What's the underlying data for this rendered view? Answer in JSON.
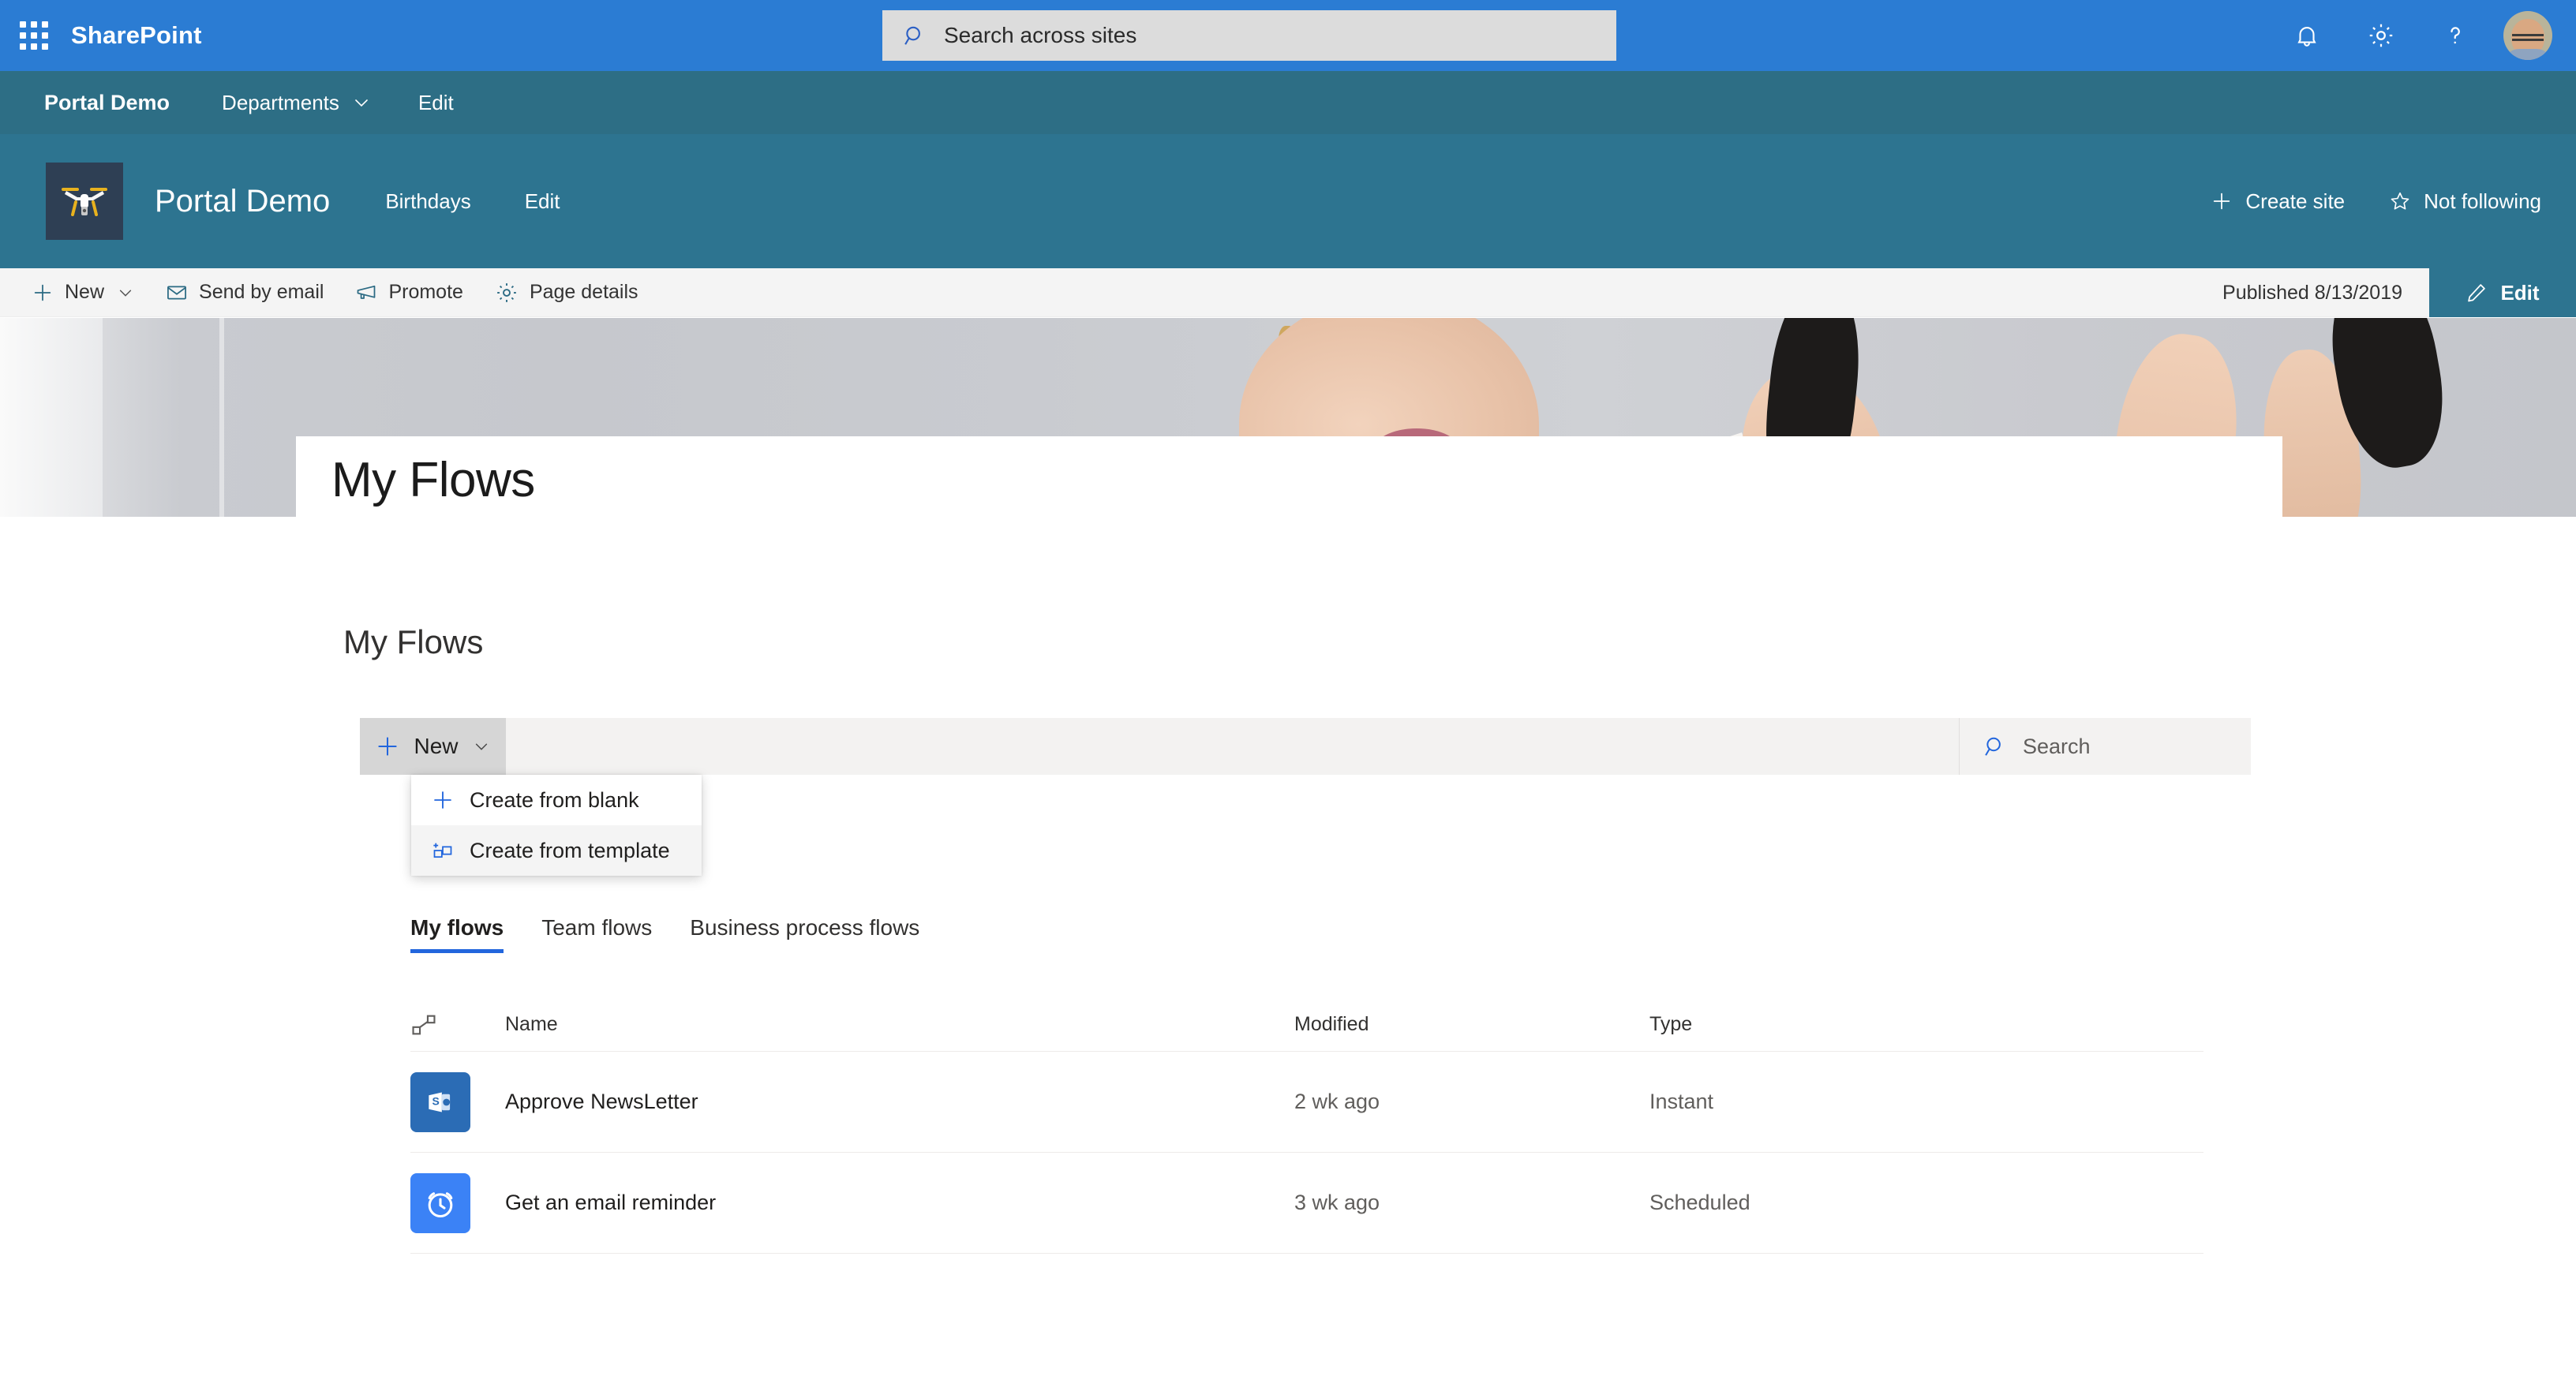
{
  "suite": {
    "waffle_icon": "app-launcher-icon",
    "brand": "SharePoint",
    "search": {
      "placeholder": "Search across sites",
      "value": "",
      "icon": "search-icon"
    },
    "icons": [
      {
        "name": "bell-icon",
        "label": "Notifications"
      },
      {
        "name": "gear-icon",
        "label": "Settings"
      },
      {
        "name": "question-icon",
        "label": "Help"
      }
    ],
    "avatar": {
      "name": "avatar",
      "label": "Account manager"
    },
    "accent": "#2b7cd3"
  },
  "hub": {
    "title": "Portal Demo",
    "links": [
      {
        "label": "Departments",
        "has_chevron": true
      },
      {
        "label": "Edit",
        "has_chevron": false
      }
    ],
    "background": "#2d6e85"
  },
  "site": {
    "logo_icon": "drone-logo-icon",
    "name": "Portal Demo",
    "nav": [
      {
        "label": "Birthdays"
      },
      {
        "label": "Edit"
      }
    ],
    "actions": [
      {
        "label": "Create site",
        "icon": "plus-icon"
      },
      {
        "label": "Not following",
        "icon": "star-icon"
      }
    ],
    "background": "#2d7490"
  },
  "command_bar": {
    "items": [
      {
        "label": "New",
        "icon": "plus-icon",
        "has_chevron": true
      },
      {
        "label": "Send by email",
        "icon": "mail-icon",
        "has_chevron": false
      },
      {
        "label": "Promote",
        "icon": "megaphone-icon",
        "has_chevron": false
      },
      {
        "label": "Page details",
        "icon": "gear-icon",
        "has_chevron": false
      }
    ],
    "published": "Published 8/13/2019",
    "edit_button": {
      "label": "Edit",
      "icon": "pencil-icon",
      "color": "#2d7490"
    }
  },
  "page": {
    "title": "My Flows"
  },
  "webpart": {
    "title": "My Flows",
    "toolbar": {
      "new_button": {
        "label": "New",
        "icon": "plus-icon",
        "has_chevron": true
      },
      "search": {
        "placeholder": "Search",
        "value": "",
        "icon": "search-icon"
      }
    },
    "dropdown": {
      "open": true,
      "items": [
        {
          "label": "Create from blank",
          "icon": "plus-icon"
        },
        {
          "label": "Create from template",
          "icon": "template-icon"
        }
      ]
    },
    "tabs": [
      {
        "label": "My flows",
        "active": true
      },
      {
        "label": "Team flows",
        "active": false
      },
      {
        "label": "Business process flows",
        "active": false
      }
    ],
    "table": {
      "columns": {
        "icon": "flow-connector-icon",
        "name": "Name",
        "modified": "Modified",
        "type": "Type"
      },
      "rows": [
        {
          "icon": "sharepoint-icon",
          "icon_color": "#2b6cb5",
          "name": "Approve NewsLetter",
          "modified": "2 wk ago",
          "type": "Instant"
        },
        {
          "icon": "alarm-clock-icon",
          "icon_color": "#3b82f6",
          "name": "Get an email reminder",
          "modified": "3 wk ago",
          "type": "Scheduled"
        }
      ]
    }
  }
}
